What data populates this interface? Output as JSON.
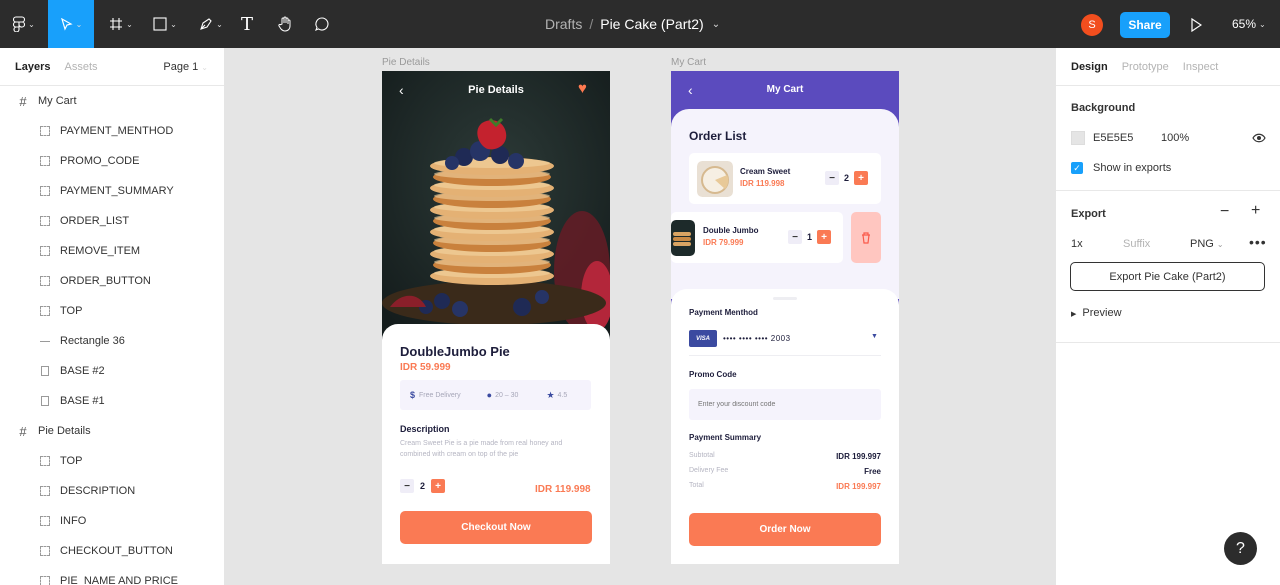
{
  "toolbar": {
    "breadcrumb_parent": "Drafts",
    "breadcrumb_separator": "/",
    "file_name": "Pie Cake (Part2)",
    "avatar_initial": "S",
    "share_label": "Share",
    "zoom": "65%",
    "tools": [
      "figma-menu-icon",
      "move-tool-icon",
      "frame-tool-icon",
      "shape-tool-icon",
      "pen-tool-icon",
      "text-tool-icon",
      "hand-tool-icon",
      "comment-tool-icon"
    ],
    "text_tool_glyph": "T"
  },
  "left_panel": {
    "tab_layers": "Layers",
    "tab_assets": "Assets",
    "page": "Page 1",
    "layers": [
      {
        "label": "My Cart",
        "type": "frame"
      },
      {
        "label": "PAYMENT_MENTHOD",
        "type": "group"
      },
      {
        "label": "PROMO_CODE",
        "type": "group"
      },
      {
        "label": "PAYMENT_SUMMARY",
        "type": "group"
      },
      {
        "label": "ORDER_LIST",
        "type": "group"
      },
      {
        "label": "REMOVE_ITEM",
        "type": "group"
      },
      {
        "label": "ORDER_BUTTON",
        "type": "group"
      },
      {
        "label": "TOP",
        "type": "group"
      },
      {
        "label": "Rectangle 36",
        "type": "line"
      },
      {
        "label": "BASE #2",
        "type": "rect"
      },
      {
        "label": "BASE #1",
        "type": "rect"
      },
      {
        "label": "Pie Details",
        "type": "frame"
      },
      {
        "label": "TOP",
        "type": "group"
      },
      {
        "label": "DESCRIPTION",
        "type": "group"
      },
      {
        "label": "INFO",
        "type": "group"
      },
      {
        "label": "CHECKOUT_BUTTON",
        "type": "group"
      },
      {
        "label": "PIE_NAME AND PRICE",
        "type": "group"
      }
    ]
  },
  "pie_details": {
    "frame_label": "Pie Details",
    "title": "Pie Details",
    "name": "DoubleJumbo Pie",
    "price": "IDR 59.999",
    "info": {
      "delivery": "Free Delivery",
      "time": "20 – 30",
      "rating": "4.5"
    },
    "description_heading": "Description",
    "description": "Cream Sweet Pie is a pie made from real honey and combined with cream on top of the pie",
    "quantity": "2",
    "total": "IDR 119.998",
    "checkout_label": "Checkout Now"
  },
  "my_cart": {
    "frame_label": "My Cart",
    "title": "My Cart",
    "order_list_heading": "Order List",
    "items": [
      {
        "name": "Cream Sweet",
        "price": "IDR 119.998",
        "qty": "2"
      },
      {
        "name": "Double Jumbo",
        "price": "IDR 79.999",
        "qty": "1"
      }
    ],
    "payment_method_heading": "Payment Menthod",
    "card_brand": "VISA",
    "card_number": "•••• •••• •••• 2003",
    "promo_heading": "Promo Code",
    "promo_placeholder": "Enter your discount code",
    "summary_heading": "Payment Summary",
    "summary": [
      {
        "label": "Subtotal",
        "value": "IDR 199.997"
      },
      {
        "label": "Delivery Fee",
        "value": "Free"
      },
      {
        "label": "Total",
        "value": "IDR 199.997"
      }
    ],
    "order_label": "Order Now"
  },
  "right_panel": {
    "tab_design": "Design",
    "tab_prototype": "Prototype",
    "tab_inspect": "Inspect",
    "background_heading": "Background",
    "bg_hex": "E5E5E5",
    "bg_opacity": "100%",
    "show_in_exports": "Show in exports",
    "export_heading": "Export",
    "export_scale": "1x",
    "suffix_placeholder": "Suffix",
    "format": "PNG",
    "export_button": "Export Pie Cake (Part2)",
    "preview": "Preview"
  },
  "help_label": "?",
  "colors": {
    "accent": "#18a0fb",
    "brand_orange": "#fa7a54",
    "brand_purple": "#5b4bbe"
  }
}
